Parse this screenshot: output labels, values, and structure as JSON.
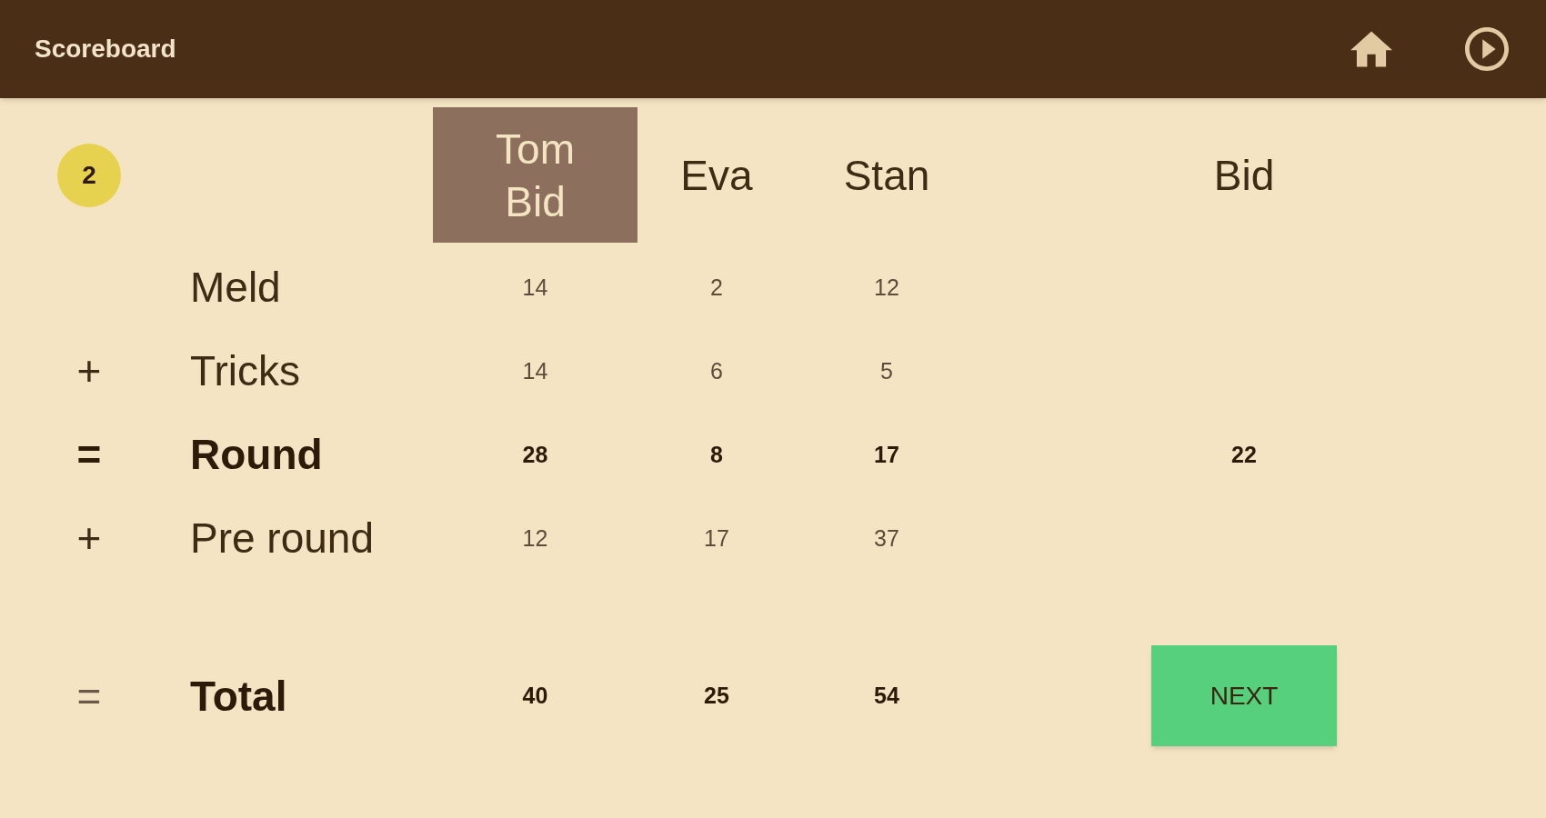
{
  "app_bar": {
    "title": "Scoreboard"
  },
  "round_badge": "2",
  "columns": [
    {
      "name": "Tom",
      "role": "Bid",
      "selected": true
    },
    {
      "name": "Eva",
      "selected": false
    },
    {
      "name": "Stan",
      "selected": false
    }
  ],
  "bid_column": {
    "heading": "Bid"
  },
  "rows": [
    {
      "label": "Meld",
      "kind": "plain",
      "values": [
        "14",
        "2",
        "12"
      ]
    },
    {
      "operator": "+",
      "label": "Tricks",
      "kind": "plain",
      "values": [
        "14",
        "6",
        "5"
      ]
    },
    {
      "operator": "=",
      "label": "Round",
      "kind": "bold",
      "values": [
        "28",
        "8",
        "17"
      ],
      "bid": "22"
    },
    {
      "operator": "+",
      "label": "Pre round",
      "kind": "plain",
      "values": [
        "12",
        "17",
        "37"
      ]
    },
    {
      "operator": "=",
      "label": "Total",
      "kind": "total",
      "values": [
        "40",
        "25",
        "54"
      ]
    }
  ],
  "next_button": {
    "label": "NEXT"
  }
}
